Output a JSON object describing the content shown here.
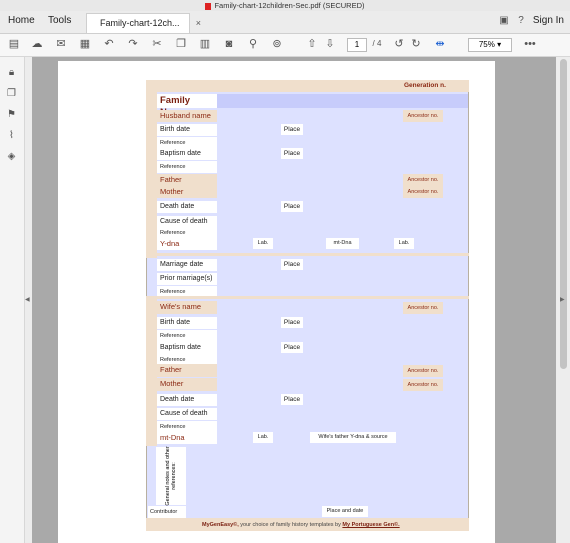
{
  "window": {
    "title": "Family-chart-12children-Sec.pdf (SECURED)"
  },
  "tabs": {
    "home": "Home",
    "tools": "Tools",
    "doc": "Family-chart-12ch...",
    "close": "×",
    "sign_in": "Sign In"
  },
  "toolbar": {
    "page_current": "1",
    "page_total": "/ 4",
    "zoom": "75%",
    "more": "•••"
  },
  "form": {
    "generation": "Generation n.",
    "family_name": "Family Name",
    "husband_name": "Husband name",
    "ancestor_no": "Ancestor no.",
    "birth_date": "Birth date",
    "place": "Place",
    "reference": "Reference",
    "baptism_date": "Baptism date",
    "father": "Father",
    "mother": "Mother",
    "death_date": "Death date",
    "cause_of_death": "Cause of death",
    "y_dna": "Y-dna",
    "lab": "Lab.",
    "mt_dna_label": "mt-Dna",
    "marriage_date": "Marriage date",
    "prior_marriages": "Prior marriage(s)",
    "wife_name": "Wife's name",
    "mt_dna": "mt-Dna",
    "wife_father_ydna": "Wife's father Y-dna & source",
    "general_notes": "General notes and other references:",
    "contributor": "Contributor",
    "place_and_date": "Place and date",
    "footer_brand": "MyGenEasy©,",
    "footer_text": "your choice of family history templates by",
    "footer_author": "My Portuguese Gen©."
  }
}
